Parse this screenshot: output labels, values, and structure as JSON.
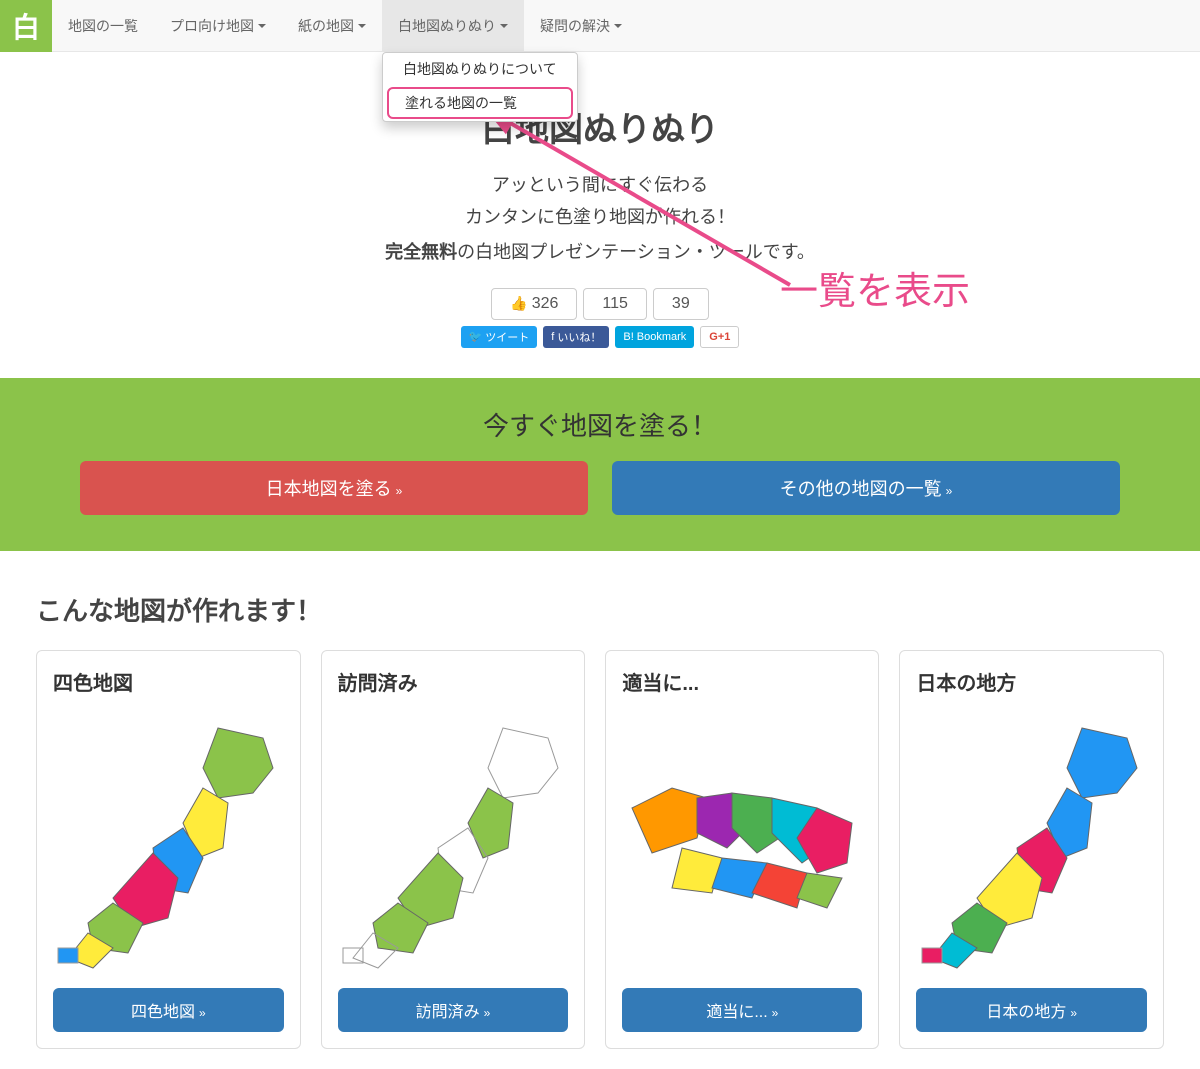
{
  "brand": "白",
  "nav": {
    "items": [
      {
        "label": "地図の一覧",
        "dropdown": false
      },
      {
        "label": "プロ向け地図",
        "dropdown": true
      },
      {
        "label": "紙の地図",
        "dropdown": true
      },
      {
        "label": "白地図ぬりぬり",
        "dropdown": true,
        "active": true
      },
      {
        "label": "疑問の解決",
        "dropdown": true
      }
    ],
    "dropdown_items": [
      {
        "label": "白地図ぬりぬりについて",
        "highlighted": false
      },
      {
        "label": "塗れる地図の一覧",
        "highlighted": true
      }
    ]
  },
  "hero": {
    "title": "白地図ぬりぬり",
    "sub1": "アッという間にすぐ伝わる",
    "sub2": "カンタンに色塗り地図が作れる！",
    "free_bold": "完全無料",
    "free_rest": "の白地図プレゼンテーション・ツールです。"
  },
  "social": {
    "count1": "326",
    "count2": "115",
    "count3": "39",
    "tweet": "ツイート",
    "like": "いいね！",
    "bookmark": "Bookmark",
    "gplus": "G+1"
  },
  "cta": {
    "title": "今すぐ地図を塗る！",
    "btn1": "日本地図を塗る",
    "btn2": "その他の地図の一覧"
  },
  "section": {
    "title": "こんな地図が作れます！"
  },
  "cards": [
    {
      "title": "四色地図",
      "btn": "四色地図"
    },
    {
      "title": "訪問済み",
      "btn": "訪問済み"
    },
    {
      "title": "適当に...",
      "btn": "適当に..."
    },
    {
      "title": "日本の地方",
      "btn": "日本の地方"
    }
  ],
  "annotation": "一覧を表示"
}
